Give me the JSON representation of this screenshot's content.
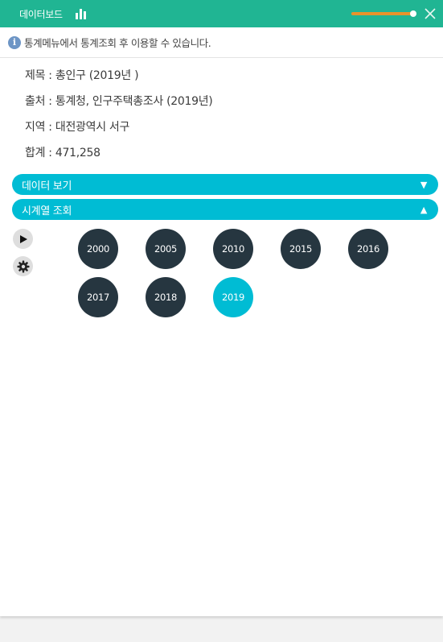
{
  "header": {
    "title": "데이터보드",
    "icon": "bar-chart-icon",
    "slider_color": "#e8932b",
    "slider_level": 0.96,
    "close_icon": "close-icon",
    "bg_color": "#20b593"
  },
  "info": {
    "icon": "info-icon",
    "text": "통계메뉴에서 통계조회 후 이용할 수 있습니다."
  },
  "meta": {
    "title": "제목 : 총인구 (2019년 )",
    "source": "출처 : 통계청, 인구주택총조사 (2019년)",
    "region": "지역 : 대전광역시 서구",
    "total": "합계 : 471,258"
  },
  "accordions": [
    {
      "label": "데이터 보기",
      "arrow": "▼",
      "color": "#00bcd4"
    },
    {
      "label": "시계열 조회",
      "arrow": "▲",
      "color": "#00bcd4"
    }
  ],
  "controls": {
    "play_icon": "play-icon",
    "settings_icon": "gear-icon"
  },
  "years": [
    {
      "label": "2000",
      "active": false
    },
    {
      "label": "2005",
      "active": false
    },
    {
      "label": "2010",
      "active": false
    },
    {
      "label": "2015",
      "active": false
    },
    {
      "label": "2016",
      "active": false
    },
    {
      "label": "2017",
      "active": false
    },
    {
      "label": "2018",
      "active": false
    },
    {
      "label": "2019",
      "active": true
    }
  ]
}
